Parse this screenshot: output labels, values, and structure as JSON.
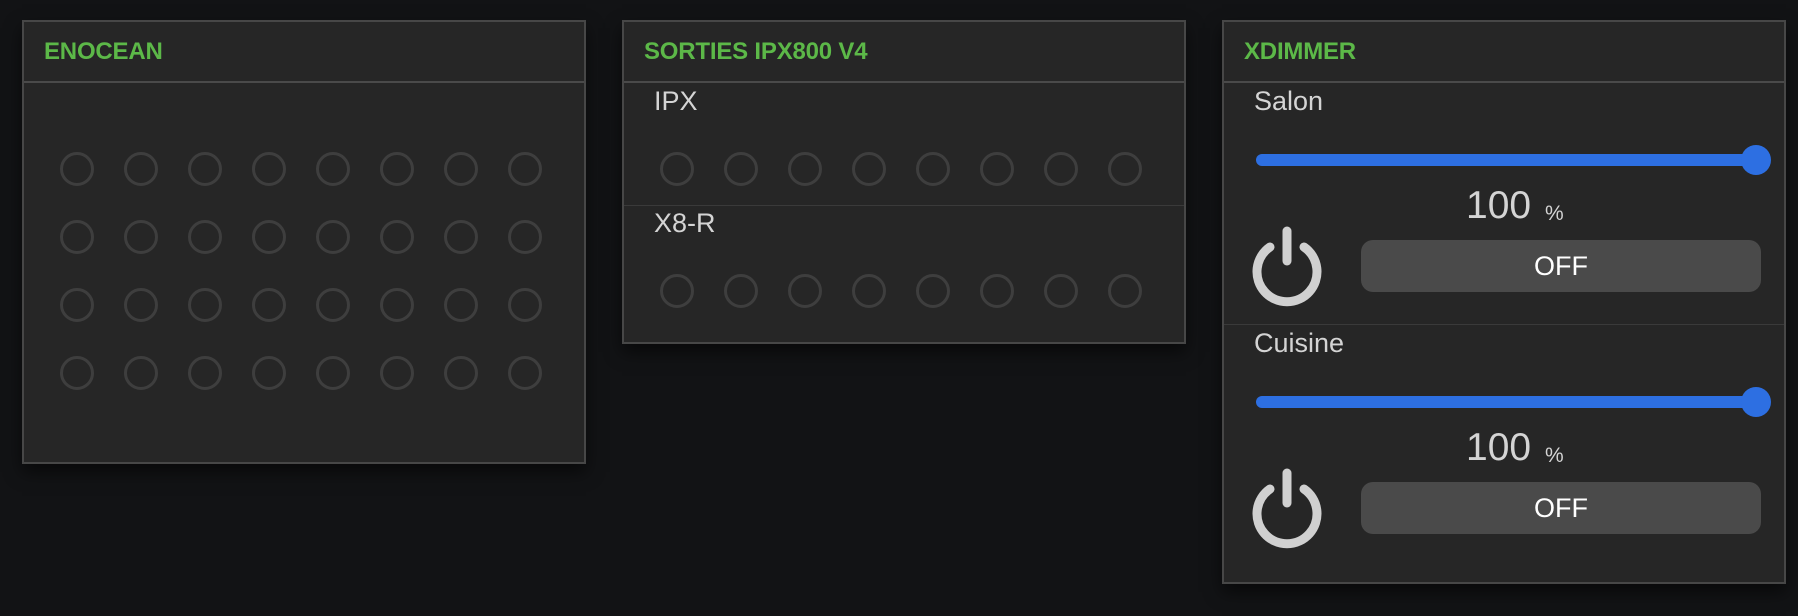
{
  "enocean": {
    "title": "ENOCEAN",
    "led_rows": 4,
    "led_cols": 8
  },
  "sorties": {
    "title": "SORTIES IPX800 V4",
    "groups": [
      {
        "label": "IPX",
        "led_count": 8
      },
      {
        "label": "X8-R",
        "led_count": 8
      }
    ]
  },
  "xdimmer": {
    "title": "XDIMMER",
    "channels": [
      {
        "label": "Salon",
        "level": 100,
        "unit": "%",
        "state_label": "OFF"
      },
      {
        "label": "Cuisine",
        "level": 100,
        "unit": "%",
        "state_label": "OFF"
      }
    ]
  },
  "colors": {
    "background": "#121315",
    "panel": "#262626",
    "title_accent": "#5cb848",
    "slider": "#2d6fe2",
    "led_off_ring": "#3e3e3e"
  },
  "icons": [
    "power-icon"
  ]
}
